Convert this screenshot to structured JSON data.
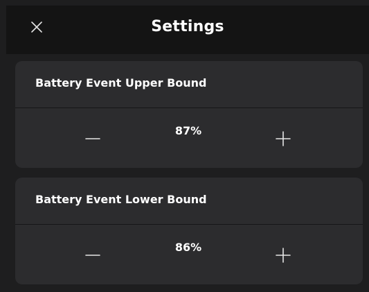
{
  "header": {
    "title": "Settings",
    "close_icon": "close-icon"
  },
  "settings": [
    {
      "label": "Battery Event Upper Bound",
      "value": "87%",
      "decrement_icon": "minus-icon",
      "increment_icon": "plus-icon"
    },
    {
      "label": "Battery Event Lower Bound",
      "value": "86%",
      "decrement_icon": "minus-icon",
      "increment_icon": "plus-icon"
    }
  ],
  "colors": {
    "background": "#1e1e1f",
    "header_background": "#141414",
    "card_background": "#2c2c2e",
    "text": "#ffffff"
  }
}
